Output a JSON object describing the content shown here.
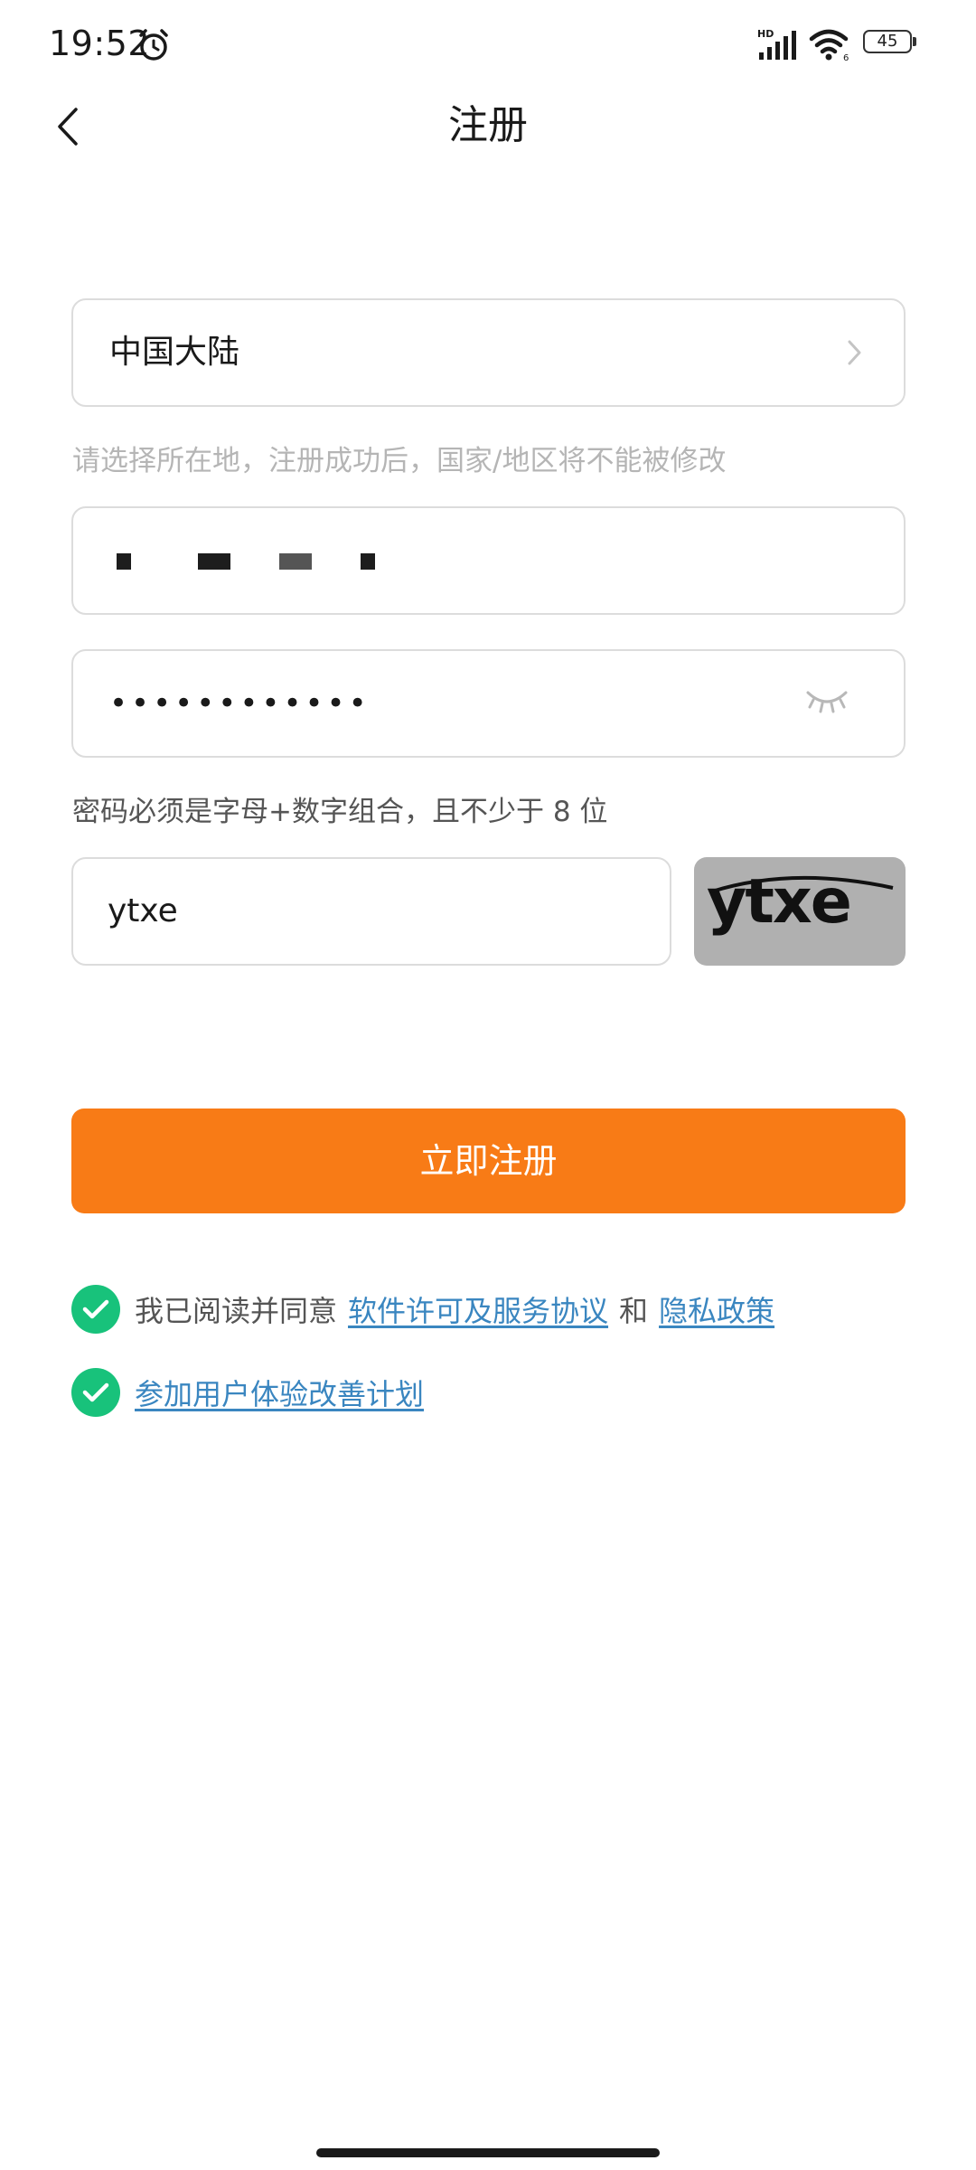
{
  "status_bar": {
    "time": "19:52",
    "network": "HD",
    "battery": "45"
  },
  "header": {
    "title": "注册"
  },
  "form": {
    "region": {
      "value": "中国大陆",
      "hint": "请选择所在地，注册成功后，国家/地区将不能被修改"
    },
    "phone": {
      "value": "(redacted)"
    },
    "password": {
      "value": "••••••••••••",
      "hint": "密码必须是字母+数字组合，且不少于 8 位"
    },
    "captcha": {
      "value": "ytxe",
      "image_text": "ytxe"
    },
    "register_button_label": "立即注册"
  },
  "agreements": {
    "agree_prefix": "我已阅读并同意",
    "license_link": "软件许可及服务协议",
    "connector": "和",
    "privacy_link": "隐私政策",
    "experience_link": "参加用户体验改善计划"
  },
  "colors": {
    "accent": "#f87b16",
    "check": "#18c27b",
    "link": "#3a86c0"
  }
}
